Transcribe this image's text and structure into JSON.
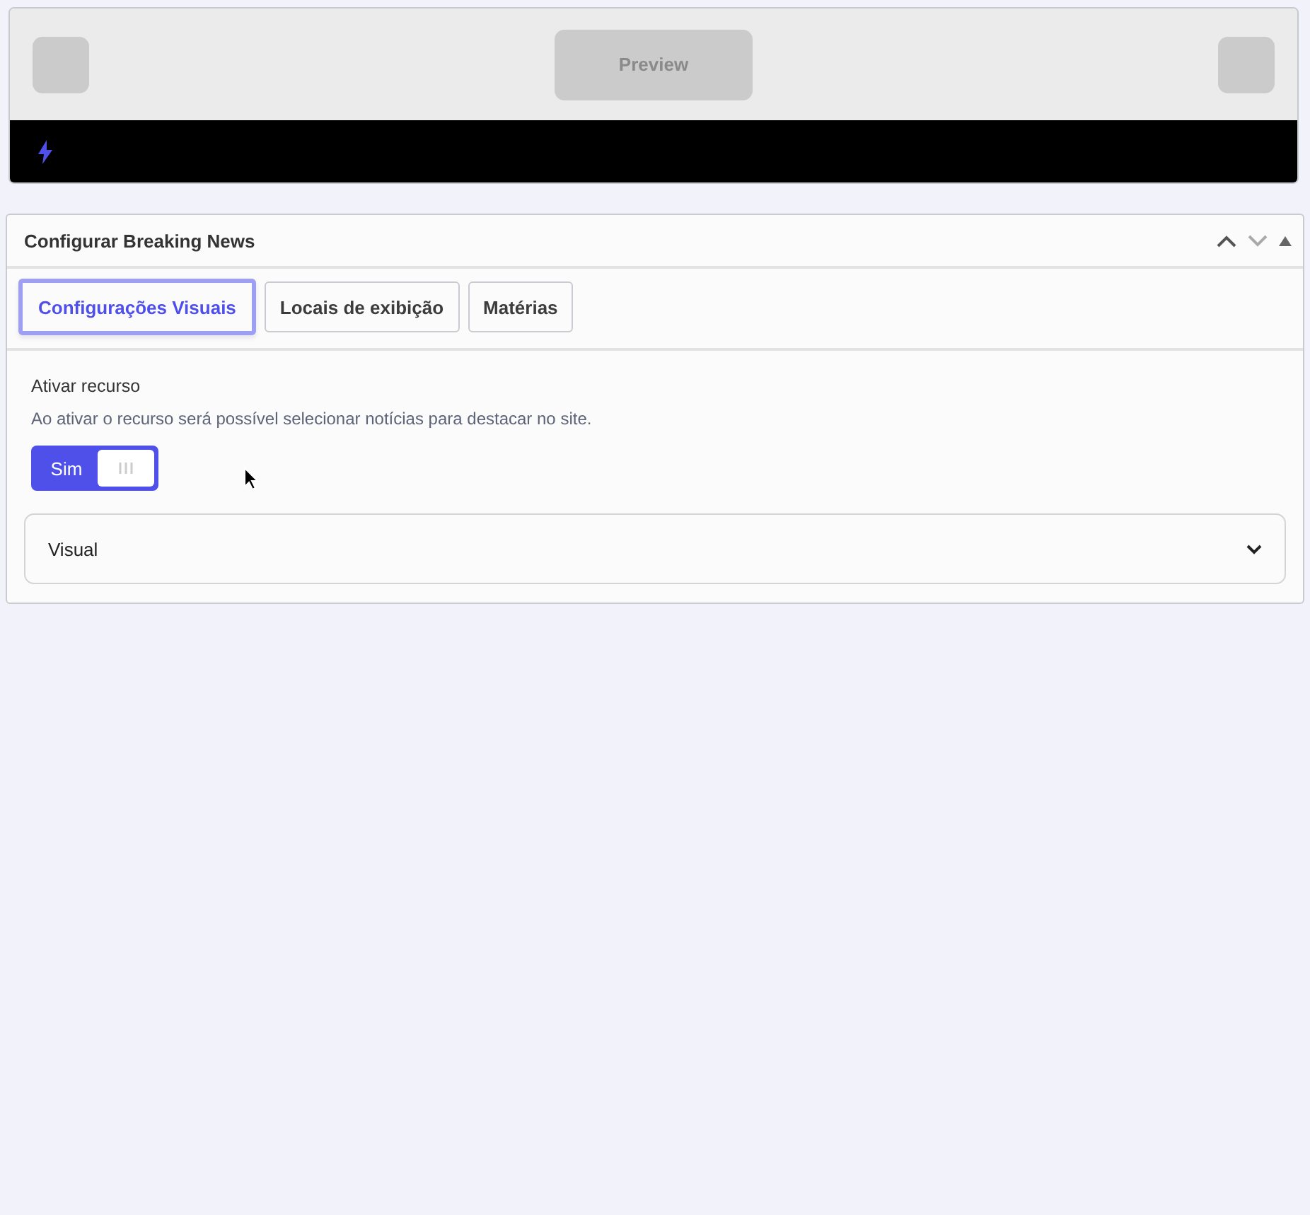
{
  "preview": {
    "button": "Preview"
  },
  "panel": {
    "title": "Configurar Breaking News",
    "tabs": [
      {
        "label": "Configurações Visuais",
        "selected": true
      },
      {
        "label": "Locais de exibição",
        "selected": false
      },
      {
        "label": "Matérias",
        "selected": false
      }
    ],
    "field": {
      "label": "Ativar recurso",
      "description": "Ao ativar o recurso será possível selecionar notícias para destacar no site.",
      "toggle": {
        "label": "Sim",
        "on": true
      }
    },
    "accordion": {
      "title": "Visual",
      "expanded": false
    }
  }
}
